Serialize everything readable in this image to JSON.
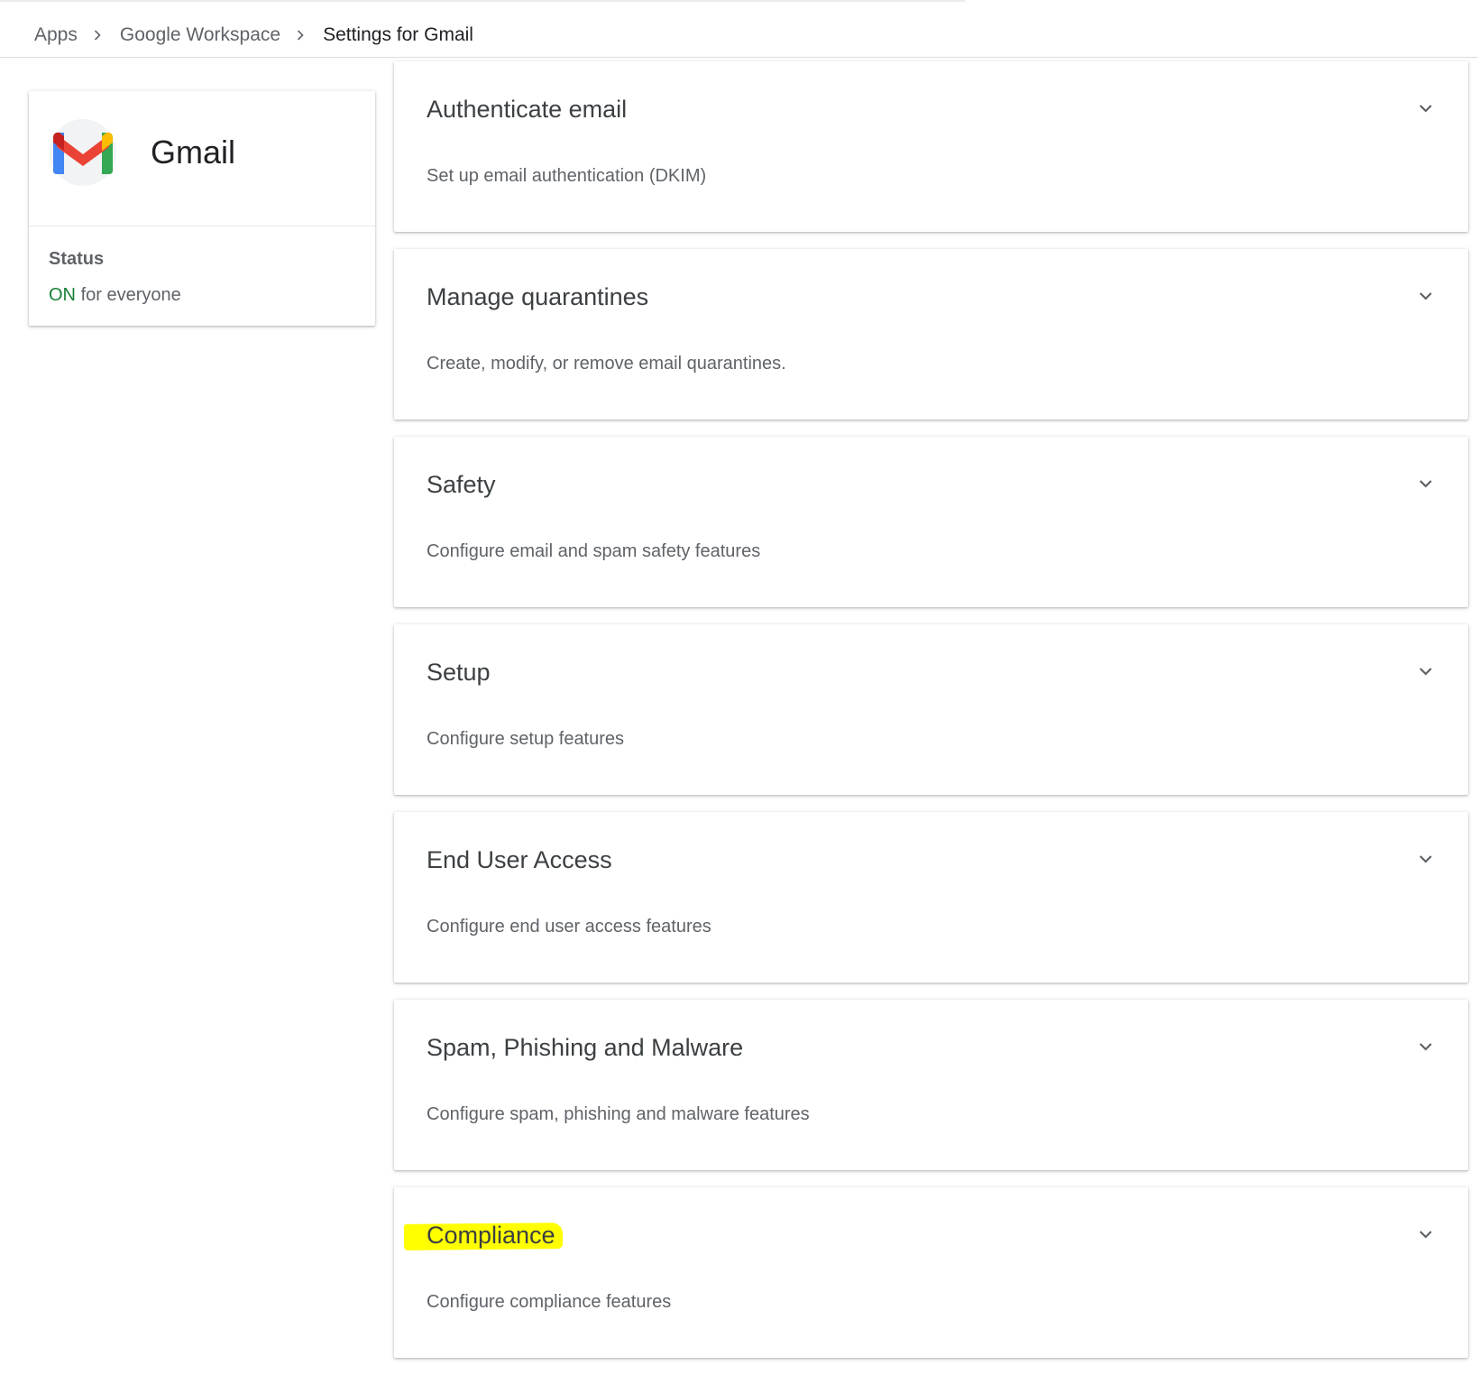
{
  "breadcrumb": {
    "items": [
      {
        "label": "Apps"
      },
      {
        "label": "Google Workspace"
      },
      {
        "label": "Settings for Gmail"
      }
    ],
    "separator_icon": "chevron-right-icon"
  },
  "app_card": {
    "logo_icon": "gmail-logo-icon",
    "name": "Gmail",
    "status_label": "Status",
    "status_value": "ON",
    "status_suffix": "for everyone",
    "status_color": "#188038"
  },
  "settings_sections": [
    {
      "title": "Authenticate email",
      "description": "Set up email authentication (DKIM)",
      "icon": "chevron-down-icon"
    },
    {
      "title": "Manage quarantines",
      "description": "Create, modify, or remove email quarantines.",
      "icon": "chevron-down-icon"
    },
    {
      "title": "Safety",
      "description": "Configure email and spam safety features",
      "icon": "chevron-down-icon"
    },
    {
      "title": "Setup",
      "description": "Configure setup features",
      "icon": "chevron-down-icon"
    },
    {
      "title": "End User Access",
      "description": "Configure end user access features",
      "icon": "chevron-down-icon"
    },
    {
      "title": "Spam, Phishing and Malware",
      "description": "Configure spam, phishing and malware features",
      "icon": "chevron-down-icon"
    },
    {
      "title": "Compliance",
      "description": "Configure compliance features",
      "icon": "chevron-down-icon",
      "highlighted": true
    }
  ],
  "colors": {
    "highlight": "#ffff00",
    "text_primary": "#202124",
    "text_secondary": "#5f6368"
  }
}
